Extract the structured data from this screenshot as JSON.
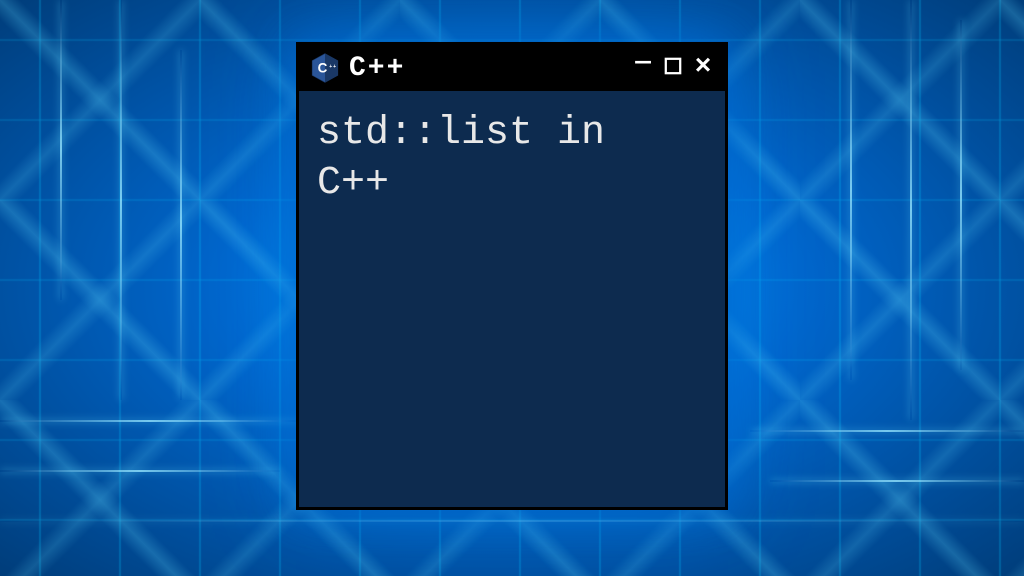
{
  "window": {
    "title": "C++",
    "icon": "cpp-icon"
  },
  "content": {
    "line1": "std::list in",
    "line2": "C++"
  }
}
